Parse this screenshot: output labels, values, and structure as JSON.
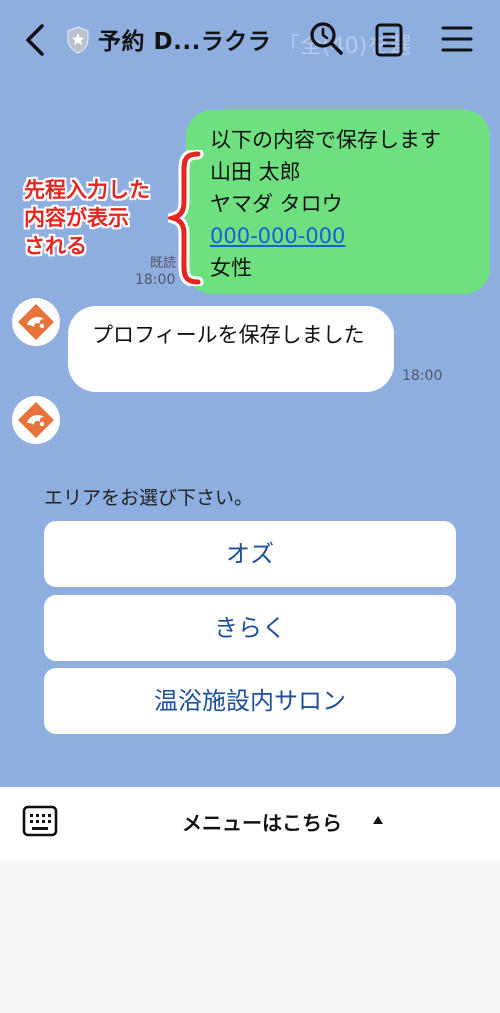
{
  "header": {
    "title": "予約 D...ラクラ",
    "background_text": "「全(40)を選"
  },
  "outgoing_message": {
    "lines": [
      "以下の内容で保存します",
      "山田 太郎",
      "ヤマダ タロウ",
      "000-000-000",
      "女性"
    ],
    "read_label": "既読",
    "time": "18:00"
  },
  "annotation": {
    "lines": [
      "先程入力した",
      "内容が表示",
      "される"
    ],
    "color": "#e52620"
  },
  "incoming_message": {
    "text": "プロフィールを保存しました",
    "time": "18:00"
  },
  "area_selection": {
    "prompt": "エリアをお選び下さい。",
    "options": [
      "オズ",
      "きらく",
      "温浴施設内サロン"
    ]
  },
  "footer": {
    "menu_label": "メニューはこちら"
  },
  "colors": {
    "chat_background": "#8eaee0",
    "outgoing_bubble": "#6fe07f",
    "link": "#1a5ddb",
    "button_text": "#1e4f9c",
    "avatar_accent": "#e8733a"
  },
  "icons": [
    "back-icon",
    "shield-icon",
    "search-icon",
    "notes-icon",
    "menu-icon",
    "keyboard-icon",
    "caret-up-icon"
  ]
}
